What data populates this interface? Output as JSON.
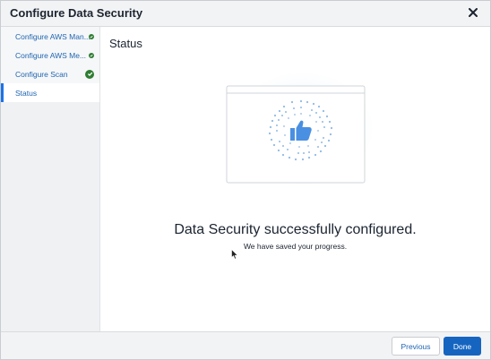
{
  "dialog": {
    "title": "Configure Data Security",
    "close_icon": "close-icon"
  },
  "sidebar": {
    "items": [
      {
        "label": "Configure AWS Man...",
        "completed": true
      },
      {
        "label": "Configure AWS Me...",
        "completed": true
      },
      {
        "label": "Configure Scan",
        "completed": true
      },
      {
        "label": "Status",
        "completed": false,
        "active": true
      }
    ]
  },
  "main": {
    "section_title": "Status",
    "illustration_icon": "thumbs-up-icon",
    "success_title": "Data Security successfully configured.",
    "success_subtitle": "We have saved your progress."
  },
  "footer": {
    "previous_label": "Previous",
    "done_label": "Done"
  },
  "colors": {
    "accent": "#1565c0",
    "link": "#2066b2",
    "success": "#2e7d32",
    "illustration_blue": "#4a90e2"
  }
}
